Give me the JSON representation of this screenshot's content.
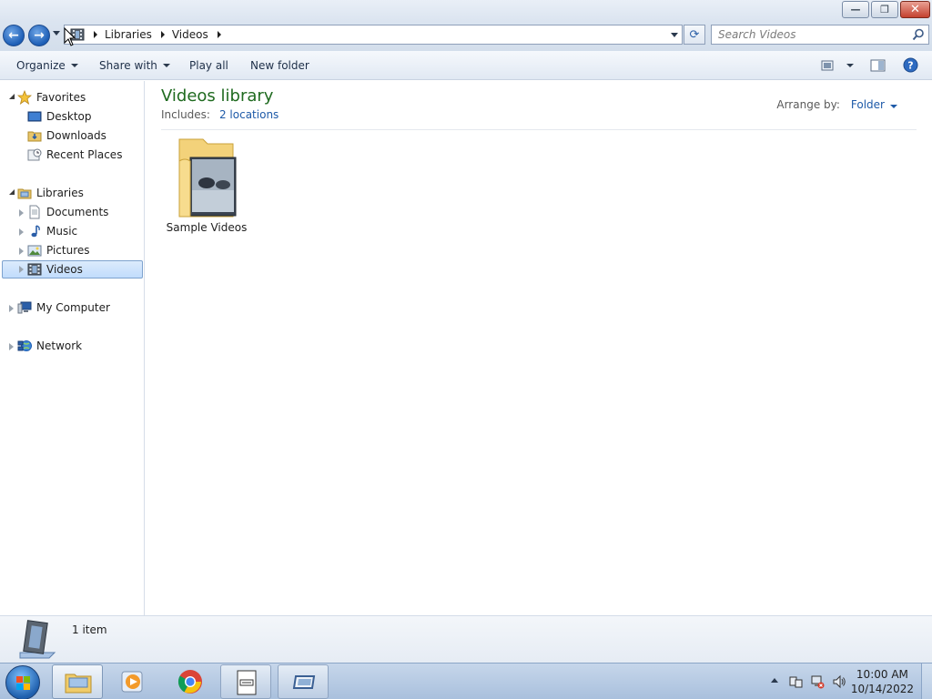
{
  "window": {
    "minimize_glyph": "—",
    "restore_glyph": "❐",
    "close_glyph": "✕"
  },
  "address": {
    "back_glyph": "←",
    "forward_glyph": "→",
    "crumbs": [
      "Libraries",
      "Videos"
    ],
    "refresh_glyph": "⟳",
    "search_placeholder": "Search Videos"
  },
  "commands": {
    "organize": "Organize",
    "share_with": "Share with",
    "play_all": "Play all",
    "new_folder": "New folder"
  },
  "nav": {
    "favorites": "Favorites",
    "desktop": "Desktop",
    "downloads": "Downloads",
    "recent_places": "Recent Places",
    "libraries": "Libraries",
    "documents": "Documents",
    "music": "Music",
    "pictures": "Pictures",
    "videos": "Videos",
    "my_computer": "My Computer",
    "network": "Network"
  },
  "content": {
    "title": "Videos library",
    "includes_label": "Includes:",
    "includes_link": "2 locations",
    "arrange_label": "Arrange by:",
    "arrange_value": "Folder",
    "items": [
      {
        "name": "Sample Videos"
      }
    ]
  },
  "details": {
    "item_count": "1 item"
  },
  "taskbar": {
    "time": "10:00 AM",
    "date": "10/14/2022"
  },
  "colors": {
    "title_green": "#1f6a1f",
    "link_blue": "#1e5aa8",
    "selection": "#c1dcfc"
  }
}
